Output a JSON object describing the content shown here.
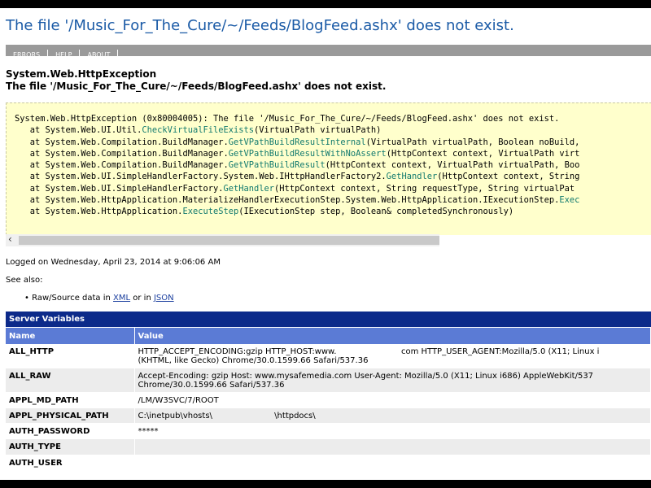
{
  "title": "The file '/Music_For_The_Cure/~/Feeds/BlogFeed.ashx' does not exist.",
  "nav": [
    "ERRORS",
    "HELP",
    "ABOUT"
  ],
  "exception_type": "System.Web.HttpException",
  "exception_message": "The file '/Music_For_The_Cure/~/Feeds/BlogFeed.ashx' does not exist.",
  "stack_trace": [
    {
      "prefix": "System.Web.HttpException (0x80004005): The file '/Music_For_The_Cure/~/Feeds/BlogFeed.ashx' does not exist.",
      "method": "",
      "args": ""
    },
    {
      "prefix": "   at System.Web.UI.Util.",
      "method": "CheckVirtualFileExists",
      "args": "(VirtualPath virtualPath)"
    },
    {
      "prefix": "   at System.Web.Compilation.BuildManager.",
      "method": "GetVPathBuildResultInternal",
      "args": "(VirtualPath virtualPath, Boolean noBuild,"
    },
    {
      "prefix": "   at System.Web.Compilation.BuildManager.",
      "method": "GetVPathBuildResultWithNoAssert",
      "args": "(HttpContext context, VirtualPath virt"
    },
    {
      "prefix": "   at System.Web.Compilation.BuildManager.",
      "method": "GetVPathBuildResult",
      "args": "(HttpContext context, VirtualPath virtualPath, Boo"
    },
    {
      "prefix": "   at System.Web.UI.SimpleHandlerFactory.System.Web.IHttpHandlerFactory2.",
      "method": "GetHandler",
      "args": "(HttpContext context, String"
    },
    {
      "prefix": "   at System.Web.UI.SimpleHandlerFactory.",
      "method": "GetHandler",
      "args": "(HttpContext context, String requestType, String virtualPat"
    },
    {
      "prefix": "   at System.Web.HttpApplication.MaterializeHandlerExecutionStep.System.Web.HttpApplication.IExecutionStep.",
      "method": "Exec",
      "args": ""
    },
    {
      "prefix": "   at System.Web.HttpApplication.",
      "method": "ExecuteStep",
      "args": "(IExecutionStep step, Boolean& completedSynchronously)"
    }
  ],
  "logged_on": "Logged on Wednesday, April 23, 2014 at 9:06:06 AM",
  "see_also": {
    "label": "See also:",
    "item_prefix": "Raw/Source data in ",
    "link_xml": "XML",
    "item_middle": " or in ",
    "link_json": "JSON"
  },
  "server_variables": {
    "heading": "Server Variables",
    "columns": [
      "Name",
      "Value"
    ],
    "rows": [
      {
        "name": "ALL_HTTP",
        "value": [
          "HTTP_ACCEPT_ENCODING:gzip HTTP_HOST:www.                         com HTTP_USER_AGENT:Mozilla/5.0 (X11; Linux i",
          "(KHTML, like Gecko) Chrome/30.0.1599.66 Safari/537.36"
        ]
      },
      {
        "name": "ALL_RAW",
        "value": [
          "Accept-Encoding: gzip Host: www.mysafemedia.com User-Agent: Mozilla/5.0 (X11; Linux i686) AppleWebKit/537",
          "Chrome/30.0.1599.66 Safari/537.36"
        ]
      },
      {
        "name": "APPL_MD_PATH",
        "value": [
          "/LM/W3SVC/7/ROOT"
        ]
      },
      {
        "name": "APPL_PHYSICAL_PATH",
        "value": [
          "C:\\inetpub\\vhosts\\                        \\httpdocs\\"
        ]
      },
      {
        "name": "AUTH_PASSWORD",
        "value": [
          "*****"
        ]
      },
      {
        "name": "AUTH_TYPE",
        "value": [
          ""
        ]
      },
      {
        "name": "AUTH_USER",
        "value": [
          ""
        ]
      }
    ]
  }
}
